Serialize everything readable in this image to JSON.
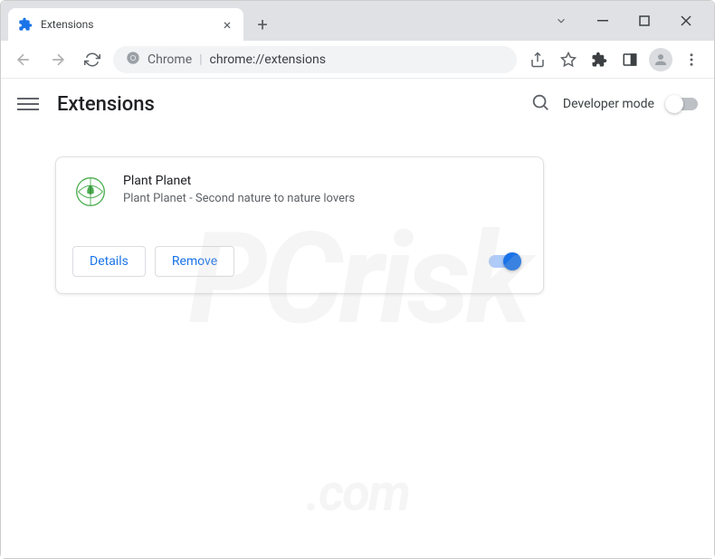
{
  "tab": {
    "title": "Extensions"
  },
  "addressbar": {
    "scheme": "Chrome",
    "url": "chrome://extensions"
  },
  "page": {
    "title": "Extensions",
    "devmode_label": "Developer mode"
  },
  "extension": {
    "name": "Plant Planet",
    "description": "Plant Planet - Second nature to nature lovers",
    "details_label": "Details",
    "remove_label": "Remove",
    "enabled": true
  }
}
